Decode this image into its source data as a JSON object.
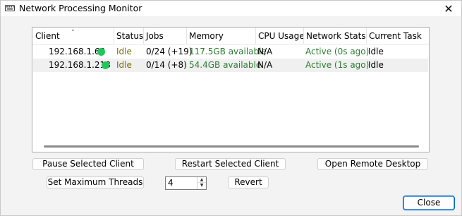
{
  "window": {
    "title": "Network Processing Monitor",
    "close_glyph": "✕"
  },
  "table": {
    "columns": [
      "Client",
      "Status",
      "Jobs",
      "Memory",
      "CPU Usage",
      "Network Stats",
      "Current Task"
    ],
    "rows": [
      {
        "client": "192.168.1.68",
        "online": true,
        "status": "Idle",
        "jobs": "0/24 (+19)",
        "memory": "117.5GB available",
        "cpu": "N/A",
        "network": "Active (0s ago)",
        "task": "Idle"
      },
      {
        "client": "192.168.1.218",
        "online": true,
        "status": "Idle",
        "jobs": "0/14 (+8)",
        "memory": "54.4GB available",
        "cpu": "N/A",
        "network": "Active (1s ago)",
        "task": "Idle"
      }
    ]
  },
  "buttons": {
    "pause": "Pause Selected Client",
    "restart": "Restart Selected Client",
    "remote": "Open Remote Desktop",
    "set_threads": "Set Maximum Threads",
    "revert": "Revert",
    "close": "Close"
  },
  "threads": {
    "value": "4"
  },
  "colors": {
    "status_idle": "#7a6a00",
    "positive_green": "#2e7d32",
    "online_dot": "#22c55e",
    "accent": "#0067c0"
  },
  "icons": {
    "app": "keyboard-icon",
    "online": "status-dot-icon"
  }
}
